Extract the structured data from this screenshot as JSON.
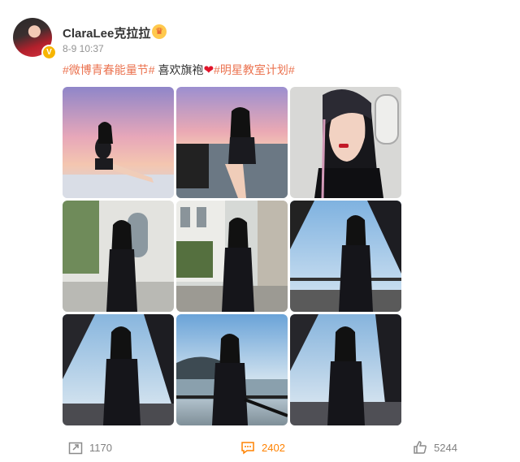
{
  "post": {
    "username": "ClaraLee克拉拉",
    "timestamp": "8-9 10:37",
    "text_parts": {
      "tag1": "#微博青春能量节#",
      "plain": " 喜欢旗袍",
      "tag2": "#明星教室计划#"
    },
    "photos": [
      {
        "scene": "sunset-seated"
      },
      {
        "scene": "sunset-chair"
      },
      {
        "scene": "closeup-window"
      },
      {
        "scene": "building-standing"
      },
      {
        "scene": "building-pose"
      },
      {
        "scene": "bridge-standing"
      },
      {
        "scene": "bridge-hip"
      },
      {
        "scene": "river-railing"
      },
      {
        "scene": "bridge-hair"
      }
    ]
  },
  "actions": {
    "share_count": "1170",
    "comment_count": "2402",
    "like_count": "5244"
  },
  "colors": {
    "tag": "#eb7350",
    "comment_active": "#ff8200",
    "muted": "#939393"
  },
  "icons": [
    "verified-badge-icon",
    "crown-badge-icon",
    "heart-icon",
    "share-icon",
    "comment-icon",
    "like-icon"
  ]
}
